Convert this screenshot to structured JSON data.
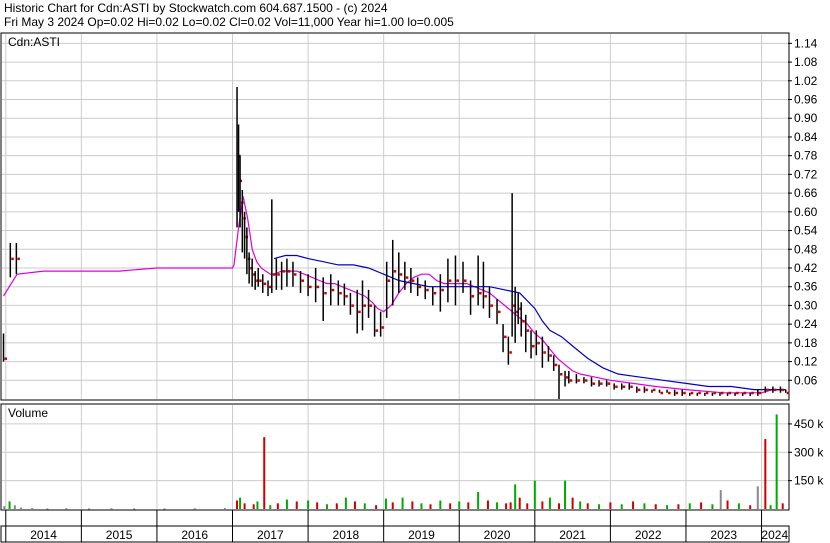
{
  "header": {
    "line1": "Historic Chart for Cdn:ASTI by Stockwatch.com 604.687.1500 - (c) 2024",
    "line2": "Fri May  3 2024  Op=0.02  Hi=0.02  Lo=0.02  Cl=0.02  Vol=11,000  Year hi=1.00  lo=0.005"
  },
  "colors": {
    "price_bar": "#000000",
    "close_dot": "#cc0000",
    "ma_short": "#dd00dd",
    "ma_long": "#0000cc",
    "vol_up": "#00aa00",
    "vol_down": "#cc0000",
    "vol_flat": "#888888",
    "grid": "#cccccc"
  },
  "chart_data": [
    {
      "type": "line",
      "label": "Cdn:ASTI",
      "y_ticks": [
        "1.14",
        "1.08",
        "1.02",
        "0.96",
        "0.90",
        "0.84",
        "0.78",
        "0.72",
        "0.66",
        "0.60",
        "0.54",
        "0.48",
        "0.42",
        "0.36",
        "0.30",
        "0.24",
        "0.18",
        "0.12",
        "0.06"
      ],
      "ylim": [
        0.0,
        1.17
      ],
      "x_ticks": [
        "2014",
        "2015",
        "2016",
        "2017",
        "2018",
        "2019",
        "2020",
        "2021",
        "2022",
        "2023",
        "2024"
      ],
      "x_tick_values": [
        2014.0,
        2015.0,
        2016.0,
        2017.0,
        2018.0,
        2019.0,
        2020.0,
        2021.0,
        2022.0,
        2023.0,
        2024.0
      ],
      "xlim": [
        2013.95,
        2024.35
      ],
      "grid": true,
      "ohlc": {
        "t": [
          2013.97,
          2014.06,
          2014.14,
          2017.06,
          2017.08,
          2017.1,
          2017.13,
          2017.16,
          2017.19,
          2017.22,
          2017.26,
          2017.3,
          2017.34,
          2017.4,
          2017.47,
          2017.52,
          2017.58,
          2017.65,
          2017.72,
          2017.8,
          2017.9,
          2018.0,
          2018.1,
          2018.2,
          2018.3,
          2018.4,
          2018.48,
          2018.56,
          2018.65,
          2018.72,
          2018.8,
          2018.88,
          2018.96,
          2019.04,
          2019.12,
          2019.2,
          2019.28,
          2019.36,
          2019.45,
          2019.55,
          2019.65,
          2019.75,
          2019.85,
          2019.95,
          2020.05,
          2020.15,
          2020.25,
          2020.32,
          2020.4,
          2020.5,
          2020.58,
          2020.65,
          2020.7,
          2020.74,
          2020.78,
          2020.82,
          2020.88,
          2020.95,
          2021.02,
          2021.1,
          2021.18,
          2021.25,
          2021.32,
          2021.4,
          2021.45,
          2021.55,
          2021.65,
          2021.75,
          2021.85,
          2021.95,
          2022.05,
          2022.15,
          2022.25,
          2022.35,
          2022.45,
          2022.55,
          2022.65,
          2022.75,
          2022.85,
          2022.95,
          2023.05,
          2023.15,
          2023.25,
          2023.35,
          2023.45,
          2023.55,
          2023.65,
          2023.75,
          2023.85,
          2023.95,
          2024.05,
          2024.15,
          2024.25,
          2024.32
        ],
        "high": [
          0.21,
          0.5,
          0.5,
          1.0,
          0.88,
          0.78,
          0.67,
          0.6,
          0.55,
          0.47,
          0.45,
          0.41,
          0.42,
          0.4,
          0.38,
          0.64,
          0.45,
          0.44,
          0.45,
          0.44,
          0.41,
          0.4,
          0.42,
          0.39,
          0.4,
          0.38,
          0.37,
          0.34,
          0.35,
          0.38,
          0.35,
          0.3,
          0.28,
          0.44,
          0.51,
          0.47,
          0.44,
          0.42,
          0.39,
          0.38,
          0.36,
          0.4,
          0.45,
          0.46,
          0.44,
          0.38,
          0.46,
          0.44,
          0.36,
          0.32,
          0.24,
          0.2,
          0.66,
          0.36,
          0.34,
          0.31,
          0.27,
          0.22,
          0.22,
          0.2,
          0.17,
          0.14,
          0.11,
          0.09,
          0.09,
          0.08,
          0.07,
          0.07,
          0.06,
          0.06,
          0.05,
          0.05,
          0.05,
          0.04,
          0.04,
          0.03,
          0.03,
          0.03,
          0.03,
          0.03,
          0.02,
          0.02,
          0.02,
          0.02,
          0.02,
          0.02,
          0.02,
          0.02,
          0.02,
          0.03,
          0.04,
          0.04,
          0.04,
          0.03
        ],
        "low": [
          0.12,
          0.39,
          0.4,
          0.55,
          0.6,
          0.55,
          0.47,
          0.45,
          0.4,
          0.37,
          0.36,
          0.35,
          0.36,
          0.34,
          0.33,
          0.34,
          0.35,
          0.35,
          0.36,
          0.36,
          0.34,
          0.33,
          0.31,
          0.25,
          0.3,
          0.3,
          0.3,
          0.27,
          0.21,
          0.22,
          0.26,
          0.2,
          0.2,
          0.26,
          0.3,
          0.34,
          0.35,
          0.34,
          0.33,
          0.32,
          0.3,
          0.28,
          0.31,
          0.3,
          0.34,
          0.27,
          0.3,
          0.29,
          0.26,
          0.24,
          0.15,
          0.11,
          0.2,
          0.18,
          0.24,
          0.2,
          0.15,
          0.13,
          0.14,
          0.1,
          0.12,
          0.09,
          0.0,
          0.04,
          0.05,
          0.05,
          0.05,
          0.04,
          0.04,
          0.04,
          0.03,
          0.03,
          0.03,
          0.02,
          0.02,
          0.02,
          0.02,
          0.02,
          0.01,
          0.01,
          0.01,
          0.01,
          0.01,
          0.01,
          0.01,
          0.01,
          0.01,
          0.01,
          0.01,
          0.01,
          0.02,
          0.02,
          0.02,
          0.02
        ],
        "close": [
          0.13,
          0.45,
          0.45,
          0.78,
          0.7,
          0.63,
          0.58,
          0.52,
          0.45,
          0.42,
          0.4,
          0.38,
          0.38,
          0.37,
          0.36,
          0.4,
          0.4,
          0.41,
          0.41,
          0.4,
          0.38,
          0.36,
          0.36,
          0.34,
          0.35,
          0.34,
          0.33,
          0.3,
          0.28,
          0.3,
          0.3,
          0.22,
          0.23,
          0.38,
          0.41,
          0.4,
          0.39,
          0.38,
          0.36,
          0.35,
          0.34,
          0.35,
          0.38,
          0.38,
          0.38,
          0.33,
          0.34,
          0.33,
          0.3,
          0.28,
          0.2,
          0.15,
          0.3,
          0.28,
          0.29,
          0.25,
          0.22,
          0.17,
          0.18,
          0.15,
          0.14,
          0.11,
          0.08,
          0.07,
          0.06,
          0.06,
          0.06,
          0.05,
          0.05,
          0.05,
          0.04,
          0.04,
          0.04,
          0.03,
          0.03,
          0.03,
          0.02,
          0.02,
          0.02,
          0.02,
          0.02,
          0.02,
          0.02,
          0.02,
          0.02,
          0.02,
          0.02,
          0.02,
          0.02,
          0.02,
          0.03,
          0.03,
          0.03,
          0.02
        ]
      },
      "series": [
        {
          "name": "",
          "color_key": "ma_short",
          "x": [
            2013.97,
            2014.15,
            2014.5,
            2015.0,
            2015.5,
            2016.0,
            2016.5,
            2017.0,
            2017.02,
            2017.08,
            2017.14,
            2017.2,
            2017.26,
            2017.32,
            2017.38,
            2017.44,
            2017.5,
            2017.55,
            2017.65,
            2017.75,
            2017.85,
            2017.95,
            2018.05,
            2018.15,
            2018.25,
            2018.35,
            2018.45,
            2018.55,
            2018.65,
            2018.75,
            2018.85,
            2018.92,
            2019.0,
            2019.1,
            2019.2,
            2019.3,
            2019.4,
            2019.5,
            2019.6,
            2019.7,
            2019.8,
            2019.9,
            2020.0,
            2020.1,
            2020.2,
            2020.3,
            2020.4,
            2020.5,
            2020.6,
            2020.7,
            2020.8,
            2020.9,
            2021.0,
            2021.1,
            2021.2,
            2021.3,
            2021.4,
            2021.5,
            2021.6,
            2021.8,
            2022.0,
            2022.3,
            2022.6,
            2023.0,
            2023.5,
            2023.8,
            2024.0,
            2024.15,
            2024.32
          ],
          "y": [
            0.33,
            0.4,
            0.41,
            0.41,
            0.41,
            0.42,
            0.42,
            0.42,
            0.43,
            0.55,
            0.65,
            0.58,
            0.48,
            0.44,
            0.42,
            0.41,
            0.4,
            0.4,
            0.41,
            0.41,
            0.41,
            0.4,
            0.39,
            0.38,
            0.37,
            0.37,
            0.36,
            0.35,
            0.34,
            0.33,
            0.31,
            0.29,
            0.28,
            0.3,
            0.34,
            0.37,
            0.39,
            0.4,
            0.4,
            0.38,
            0.37,
            0.37,
            0.37,
            0.37,
            0.36,
            0.35,
            0.34,
            0.32,
            0.3,
            0.28,
            0.26,
            0.24,
            0.21,
            0.19,
            0.16,
            0.13,
            0.11,
            0.09,
            0.08,
            0.07,
            0.06,
            0.05,
            0.04,
            0.03,
            0.02,
            0.02,
            0.02,
            0.03,
            0.03
          ]
        },
        {
          "name": "",
          "color_key": "ma_long",
          "x": [
            2017.55,
            2017.7,
            2017.85,
            2018.0,
            2018.2,
            2018.4,
            2018.6,
            2018.8,
            2019.0,
            2019.2,
            2019.4,
            2019.6,
            2019.8,
            2020.0,
            2020.2,
            2020.4,
            2020.6,
            2020.8,
            2021.0,
            2021.1,
            2021.2,
            2021.35,
            2021.5,
            2021.7,
            2021.9,
            2022.1,
            2022.4,
            2022.7,
            2023.0,
            2023.3,
            2023.6,
            2023.9,
            2024.05,
            2024.2,
            2024.32
          ],
          "y": [
            0.45,
            0.46,
            0.46,
            0.45,
            0.44,
            0.43,
            0.43,
            0.42,
            0.4,
            0.38,
            0.37,
            0.36,
            0.36,
            0.36,
            0.36,
            0.36,
            0.35,
            0.34,
            0.29,
            0.25,
            0.22,
            0.2,
            0.17,
            0.13,
            0.1,
            0.08,
            0.07,
            0.06,
            0.05,
            0.04,
            0.04,
            0.03,
            0.03,
            0.03,
            0.03
          ]
        }
      ]
    },
    {
      "type": "bar",
      "label": "Volume",
      "y_ticks": [
        "450 k",
        "300 k",
        "150 k"
      ],
      "y_tick_values": [
        450000,
        300000,
        150000
      ],
      "ylim": [
        0,
        550000
      ],
      "bars": {
        "t": [
          2013.98,
          2014.05,
          2014.12,
          2014.2,
          2014.35,
          2014.55,
          2014.8,
          2015.1,
          2015.4,
          2015.7,
          2016.1,
          2016.5,
          2016.9,
          2017.06,
          2017.1,
          2017.16,
          2017.28,
          2017.33,
          2017.42,
          2017.5,
          2017.6,
          2017.72,
          2017.85,
          2018.0,
          2018.12,
          2018.25,
          2018.38,
          2018.5,
          2018.62,
          2018.75,
          2018.9,
          2019.03,
          2019.12,
          2019.25,
          2019.38,
          2019.5,
          2019.62,
          2019.75,
          2019.88,
          2020.0,
          2020.12,
          2020.25,
          2020.38,
          2020.5,
          2020.62,
          2020.68,
          2020.74,
          2020.8,
          2020.9,
          2021.0,
          2021.1,
          2021.2,
          2021.32,
          2021.4,
          2021.5,
          2021.6,
          2021.7,
          2021.85,
          2022.0,
          2022.15,
          2022.3,
          2022.45,
          2022.6,
          2022.75,
          2022.9,
          2023.05,
          2023.2,
          2023.35,
          2023.46,
          2023.55,
          2023.7,
          2023.85,
          2023.95,
          2024.05,
          2024.12,
          2024.2,
          2024.28
        ],
        "v": [
          15000,
          40000,
          20000,
          8000,
          5000,
          3000,
          4000,
          3000,
          4000,
          3000,
          3000,
          4000,
          5000,
          45000,
          60000,
          30000,
          25000,
          40000,
          380000,
          20000,
          30000,
          50000,
          40000,
          45000,
          35000,
          25000,
          30000,
          60000,
          40000,
          30000,
          20000,
          55000,
          35000,
          60000,
          40000,
          30000,
          25000,
          45000,
          30000,
          40000,
          35000,
          90000,
          45000,
          35000,
          30000,
          35000,
          130000,
          60000,
          30000,
          150000,
          40000,
          60000,
          30000,
          150000,
          60000,
          40000,
          30000,
          25000,
          35000,
          25000,
          40000,
          30000,
          25000,
          20000,
          25000,
          30000,
          35000,
          25000,
          100000,
          45000,
          30000,
          20000,
          120000,
          370000,
          20000,
          500000,
          30000
        ],
        "dir": [
          "flat",
          "up",
          "flat",
          "flat",
          "flat",
          "flat",
          "flat",
          "flat",
          "flat",
          "flat",
          "flat",
          "flat",
          "flat",
          "down",
          "up",
          "down",
          "down",
          "up",
          "down",
          "up",
          "down",
          "up",
          "down",
          "up",
          "down",
          "up",
          "down",
          "up",
          "down",
          "up",
          "down",
          "up",
          "down",
          "up",
          "down",
          "up",
          "down",
          "up",
          "down",
          "up",
          "down",
          "up",
          "down",
          "up",
          "down",
          "down",
          "up",
          "down",
          "down",
          "up",
          "down",
          "up",
          "down",
          "up",
          "down",
          "up",
          "down",
          "up",
          "down",
          "up",
          "down",
          "up",
          "down",
          "up",
          "down",
          "up",
          "down",
          "up",
          "flat",
          "down",
          "up",
          "down",
          "flat",
          "down",
          "up",
          "up",
          "down"
        ]
      }
    }
  ]
}
